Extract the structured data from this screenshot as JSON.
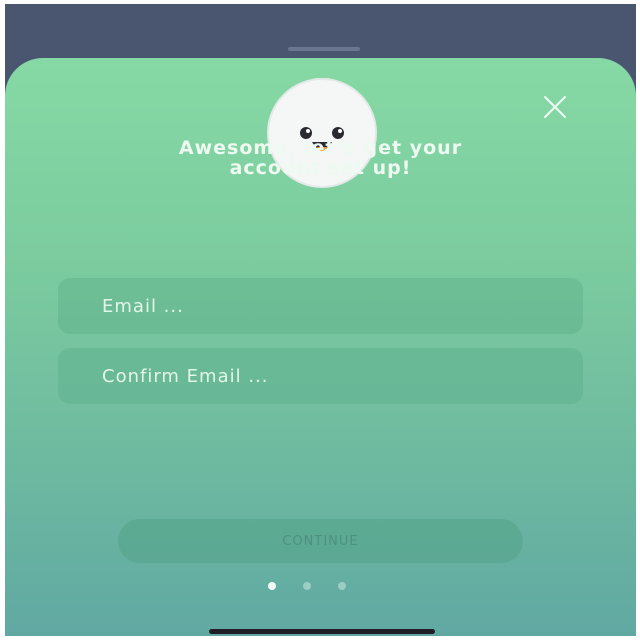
{
  "heading": {
    "line1": "Awesome, let’s get your",
    "line2": "account set up!"
  },
  "form": {
    "email_placeholder": "Email ...",
    "confirm_placeholder": "Confirm Email ..."
  },
  "continue_label": "CONTINUE",
  "pagination": {
    "current": 1,
    "total": 3
  },
  "icons": {
    "close": "close-icon",
    "mascot": "mascot-icon"
  },
  "colors": {
    "gradient_top": "#86d9a4",
    "gradient_bottom": "#5fa6a3",
    "backdrop": "#4a5670",
    "text": "#eef9f1"
  }
}
